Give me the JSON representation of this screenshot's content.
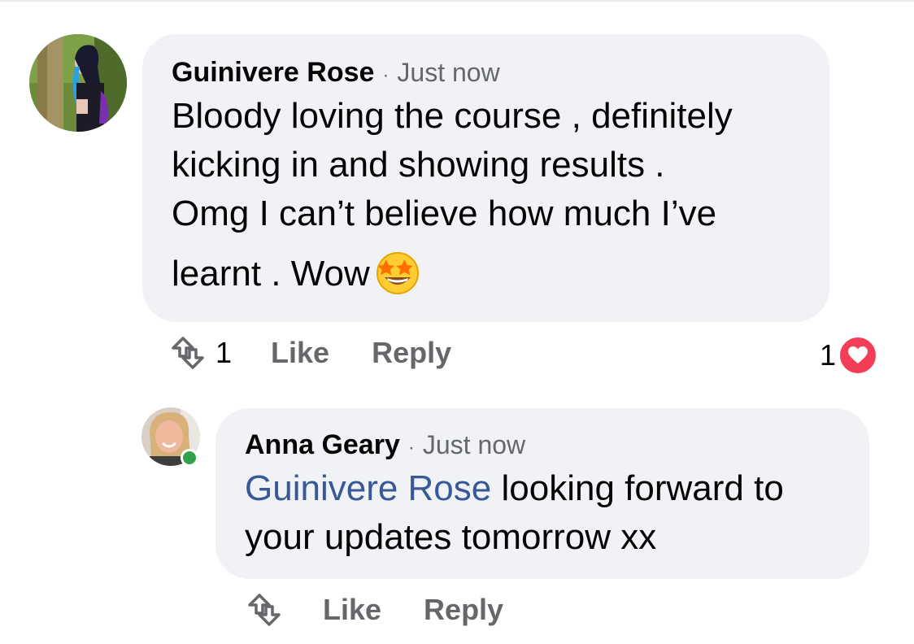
{
  "comments": [
    {
      "author": "Guinivere Rose",
      "separator": "·",
      "time": "Just now",
      "body_lines": [
        "Bloody loving the course , definitely",
        "kicking in and showing results .",
        "Omg I can’t believe how much I’ve",
        "learnt . Wow"
      ],
      "emoji": "star-struck-emoji",
      "actions": {
        "share_count": "1",
        "like": "Like",
        "reply": "Reply"
      },
      "reaction": {
        "count": "1",
        "icon": "heart-reaction-icon",
        "color": "#f33e58"
      }
    },
    {
      "author": "Anna Geary",
      "separator": "·",
      "time": "Just now",
      "mention": "Guinivere Rose",
      "body_after_mention": " looking forward to",
      "body_line_2": "your updates tomorrow xx",
      "online": true,
      "actions": {
        "like": "Like",
        "reply": "Reply"
      }
    }
  ],
  "colors": {
    "bubble": "#f0f2f5",
    "meta_text": "#65676b",
    "mention": "#385898",
    "online": "#31a24c"
  }
}
